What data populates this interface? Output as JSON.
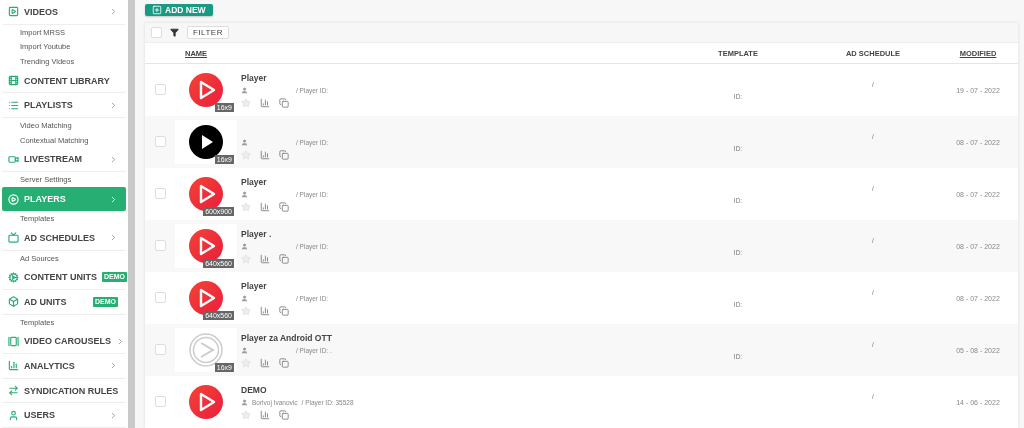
{
  "sidebar": {
    "items": [
      {
        "label": "VIDEOS",
        "kind": "main",
        "selected": false,
        "expandable": true
      },
      {
        "label": "Import MRSS",
        "kind": "sub",
        "selected": false
      },
      {
        "label": "Import Youtube",
        "kind": "sub",
        "selected": false
      },
      {
        "label": "Trending Videos",
        "kind": "sub",
        "selected": false
      },
      {
        "label": "CONTENT LIBRARY",
        "kind": "main",
        "selected": false
      },
      {
        "label": "PLAYLISTS",
        "kind": "main",
        "selected": false,
        "expandable": true
      },
      {
        "label": "Video Matching",
        "kind": "sub",
        "selected": false
      },
      {
        "label": "Contextual Matching",
        "kind": "sub",
        "selected": false
      },
      {
        "label": "LIVESTREAM",
        "kind": "main",
        "selected": false,
        "expandable": true
      },
      {
        "label": "Server Settings",
        "kind": "sub",
        "selected": false
      },
      {
        "label": "PLAYERS",
        "kind": "main",
        "selected": true,
        "expandable": true
      },
      {
        "label": "Templates",
        "kind": "sub",
        "selected": false
      },
      {
        "label": "AD SCHEDULES",
        "kind": "main",
        "selected": false,
        "expandable": true
      },
      {
        "label": "Ad Sources",
        "kind": "sub",
        "selected": false
      },
      {
        "label": "CONTENT UNITS",
        "kind": "main",
        "selected": false,
        "badge": "DEMO"
      },
      {
        "label": "AD UNITS",
        "kind": "main",
        "selected": false,
        "badge": "DEMO"
      },
      {
        "label": "Templates",
        "kind": "sub",
        "selected": false
      },
      {
        "label": "VIDEO CAROUSELS",
        "kind": "main",
        "selected": false,
        "expandable": true
      },
      {
        "label": "ANALYTICS",
        "kind": "main",
        "selected": false,
        "expandable": true
      },
      {
        "label": "SYNDICATION RULES",
        "kind": "main",
        "selected": false
      },
      {
        "label": "USERS",
        "kind": "main",
        "selected": false,
        "expandable": true
      }
    ]
  },
  "toolbar": {
    "add_button": "ADD NEW",
    "filter_button": "FILTER",
    "select_all": {
      "checked": false
    }
  },
  "table": {
    "columns": [
      {
        "label": "NAME",
        "sortable": true
      },
      {
        "label": "TEMPLATE",
        "sortable": false
      },
      {
        "label": "AD SCHEDULE",
        "sortable": false
      },
      {
        "label": "MODIFIED",
        "sortable": true
      }
    ],
    "rows": [
      {
        "title": "Player",
        "kind": "red",
        "size": "16x9",
        "player_id": "/ Player ID:",
        "template": "ID:",
        "ad_schedule": "/",
        "modified": "19 - 07 - 2022",
        "checked": false
      },
      {
        "kind": "black",
        "size": "16x9",
        "player_id": "/ Player ID:",
        "template": "ID:",
        "ad_schedule": "/",
        "modified": "08 - 07 - 2022",
        "checked": false
      },
      {
        "title": "Player",
        "kind": "red",
        "size": "600x900",
        "player_id": "/ Player ID:",
        "template": "ID:",
        "ad_schedule": "/",
        "modified": "08 - 07 - 2022",
        "checked": false
      },
      {
        "title": "Player .",
        "kind": "red",
        "size": "640x560",
        "player_id": "/ Player ID:",
        "template": "ID:",
        "ad_schedule": "/",
        "modified": "08 - 07 - 2022",
        "checked": false
      },
      {
        "title": "Player",
        "kind": "red",
        "size": "640x560",
        "player_id": "/ Player ID:",
        "template": "ID:",
        "ad_schedule": "/",
        "modified": "08 - 07 - 2022",
        "checked": false
      },
      {
        "title": "Player za Android OTT",
        "kind": "outline",
        "size": "16x9",
        "player_id": "/ Player ID: .",
        "template": "ID:",
        "ad_schedule": "/",
        "modified": "05 - 08 - 2022",
        "checked": false
      },
      {
        "title": "DEMO",
        "kind": "red",
        "author": "Borivoj Ivanovic",
        "player_id": "/ Player ID: 35528",
        "ad_schedule": "/",
        "modified": "14 - 06 - 2022",
        "checked": false
      }
    ]
  }
}
